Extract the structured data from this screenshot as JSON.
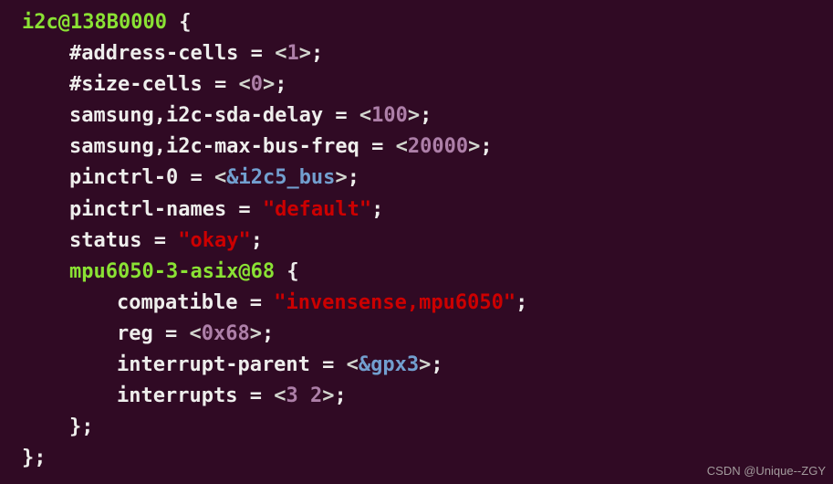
{
  "code": {
    "node_name": "i2c@138B0000",
    "open_brace": " {",
    "props": {
      "address_cells_key": "#address-cells",
      "address_cells_val": "1",
      "size_cells_key": "#size-cells",
      "size_cells_val": "0",
      "sda_delay_key": "samsung,i2c-sda-delay",
      "sda_delay_val": "100",
      "max_bus_freq_key": "samsung,i2c-max-bus-freq",
      "max_bus_freq_val": "20000",
      "pinctrl0_key": "pinctrl-0",
      "pinctrl0_ref": "&i2c5_bus",
      "pinctrl_names_key": "pinctrl-names",
      "pinctrl_names_val": "\"default\"",
      "status_key": "status",
      "status_val": "\"okay\""
    },
    "child": {
      "node_name": "mpu6050-3-asix@68",
      "open_brace": " {",
      "compatible_key": "compatible",
      "compatible_val": "\"invensense,mpu6050\"",
      "reg_key": "reg",
      "reg_val": "0x68",
      "int_parent_key": "interrupt-parent",
      "int_parent_ref": "&gpx3",
      "interrupts_key": "interrupts",
      "interrupts_val1": "3",
      "interrupts_val2": "2",
      "close": "};"
    },
    "close": "};"
  },
  "tokens": {
    "eq": " = ",
    "lt": "<",
    "gt": ">",
    "semi": ";",
    "space": " "
  },
  "watermark": "CSDN @Unique--ZGY"
}
